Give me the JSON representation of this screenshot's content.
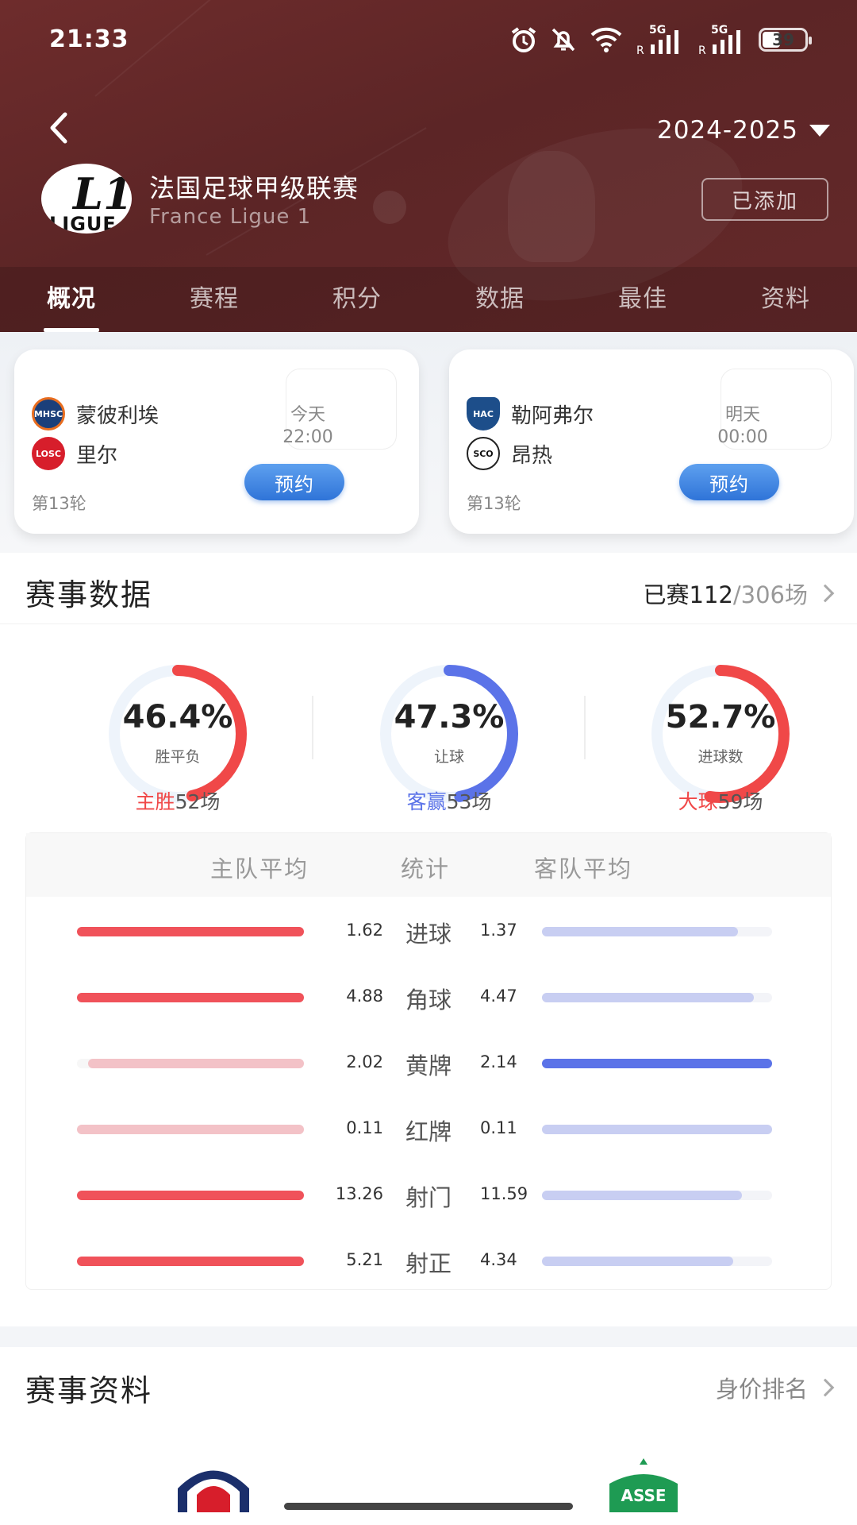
{
  "status_bar": {
    "time": "21:33",
    "battery": "39",
    "net1": "5G",
    "net2": "5G"
  },
  "header": {
    "season": "2024-2025",
    "league_name_cn": "法国足球甲级联赛",
    "league_name_en": "France Ligue 1",
    "logo_text_top": "L1",
    "logo_text_bottom": "LIGUE 1",
    "added_label": "已添加"
  },
  "tabs": [
    {
      "label": "概况",
      "active": true
    },
    {
      "label": "赛程"
    },
    {
      "label": "积分"
    },
    {
      "label": "数据"
    },
    {
      "label": "最佳"
    },
    {
      "label": "资料"
    }
  ],
  "matches": [
    {
      "home": "蒙彼利埃",
      "away": "里尔",
      "day": "今天",
      "time": "22:00",
      "round": "第13轮",
      "book": "预约",
      "home_badge": "MHSC",
      "away_badge": "LOSC"
    },
    {
      "home": "勒阿弗尔",
      "away": "昂热",
      "day": "明天",
      "time": "00:00",
      "round": "第13轮",
      "book": "预约",
      "home_badge": "HAC",
      "away_badge": "SCO"
    }
  ],
  "stats": {
    "title": "赛事数据",
    "played_label": "已赛",
    "played": "112",
    "total": "/306场",
    "rings": [
      {
        "pct": "46.4%",
        "value": 46.4,
        "label": "胜平负",
        "cap_key": "主胜",
        "cap_val": "52场",
        "color": "#f04848"
      },
      {
        "pct": "47.3%",
        "value": 47.3,
        "label": "让球",
        "cap_key": "客赢",
        "cap_val": "53场",
        "color": "#5b73e8"
      },
      {
        "pct": "52.7%",
        "value": 52.7,
        "label": "进球数",
        "cap_key": "大球",
        "cap_val": "59场",
        "color": "#f04848"
      }
    ],
    "table_head": {
      "home": "主队平均",
      "stat": "统计",
      "away": "客队平均"
    },
    "rows": [
      {
        "name": "进球",
        "home": "1.62",
        "away": "1.37",
        "home_frac": 1.0,
        "away_frac": 0.85,
        "home_strong": true,
        "away_strong": false
      },
      {
        "name": "角球",
        "home": "4.88",
        "away": "4.47",
        "home_frac": 1.0,
        "away_frac": 0.92,
        "home_strong": true,
        "away_strong": false
      },
      {
        "name": "黄牌",
        "home": "2.02",
        "away": "2.14",
        "home_frac": 0.95,
        "away_frac": 1.0,
        "home_strong": false,
        "away_strong": true
      },
      {
        "name": "红牌",
        "home": "0.11",
        "away": "0.11",
        "home_frac": 1.0,
        "away_frac": 1.0,
        "home_strong": false,
        "away_strong": false
      },
      {
        "name": "射门",
        "home": "13.26",
        "away": "11.59",
        "home_frac": 1.0,
        "away_frac": 0.87,
        "home_strong": true,
        "away_strong": false
      },
      {
        "name": "射正",
        "home": "5.21",
        "away": "4.34",
        "home_frac": 1.0,
        "away_frac": 0.83,
        "home_strong": true,
        "away_strong": false
      }
    ]
  },
  "info": {
    "title": "赛事资料",
    "link": "身价排名"
  },
  "colors": {
    "header": "#5e2627",
    "home": "#f0525a",
    "away": "#5b73e8",
    "away_light": "#c8cef2",
    "home_light": "#f3c2c7"
  }
}
